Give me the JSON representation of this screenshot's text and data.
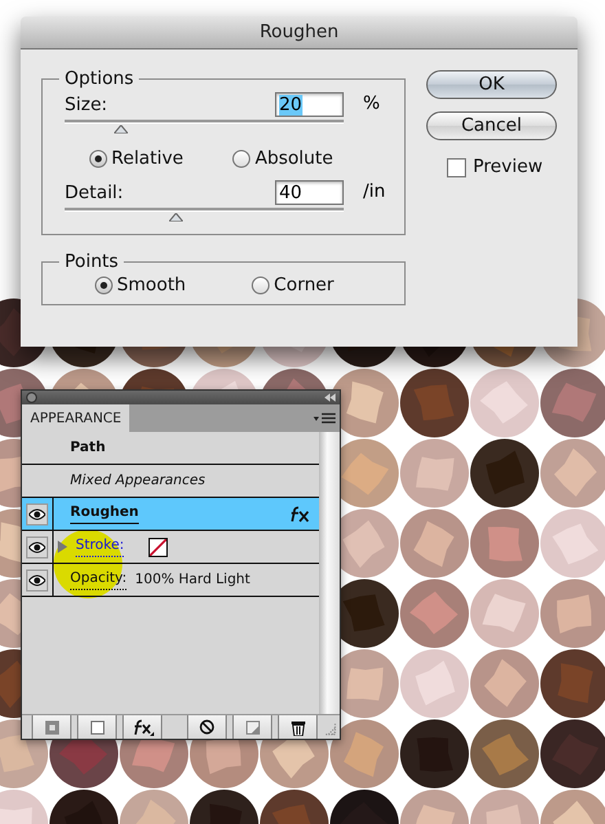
{
  "dialog": {
    "title": "Roughen",
    "options": {
      "legend": "Options",
      "size": {
        "label": "Size:",
        "value": "20",
        "highlighted": true,
        "unit": "%",
        "level": 0.2
      },
      "modes": [
        {
          "label": "Relative",
          "selected": true
        },
        {
          "label": "Absolute",
          "selected": false
        }
      ],
      "detail": {
        "label": "Detail:",
        "value": "40",
        "highlighted": false,
        "unit": "/in",
        "level": 0.4
      }
    },
    "points": {
      "legend": "Points",
      "options": [
        {
          "label": "Smooth",
          "selected": true
        },
        {
          "label": "Corner",
          "selected": false
        }
      ]
    },
    "buttons": [
      {
        "label": "OK",
        "default": true
      },
      {
        "label": "Cancel",
        "default": false
      }
    ],
    "preview": {
      "label": "Preview",
      "checked": false
    }
  },
  "panel": {
    "tabs": [
      {
        "label": "APPEARANCE",
        "selected": true
      }
    ],
    "rows": [
      {
        "kind": "header",
        "label": "Path",
        "selected": false
      },
      {
        "kind": "note",
        "label": "Mixed Appearances",
        "selected": false
      },
      {
        "kind": "effect",
        "label": "Roughen",
        "selected": true,
        "visible": true
      },
      {
        "kind": "stroke",
        "label": "Stroke:",
        "selected": false,
        "visible": true
      },
      {
        "kind": "opacity",
        "label": "Opacity:",
        "value": "100% Hard Light",
        "selected": false,
        "visible": true
      }
    ]
  }
}
